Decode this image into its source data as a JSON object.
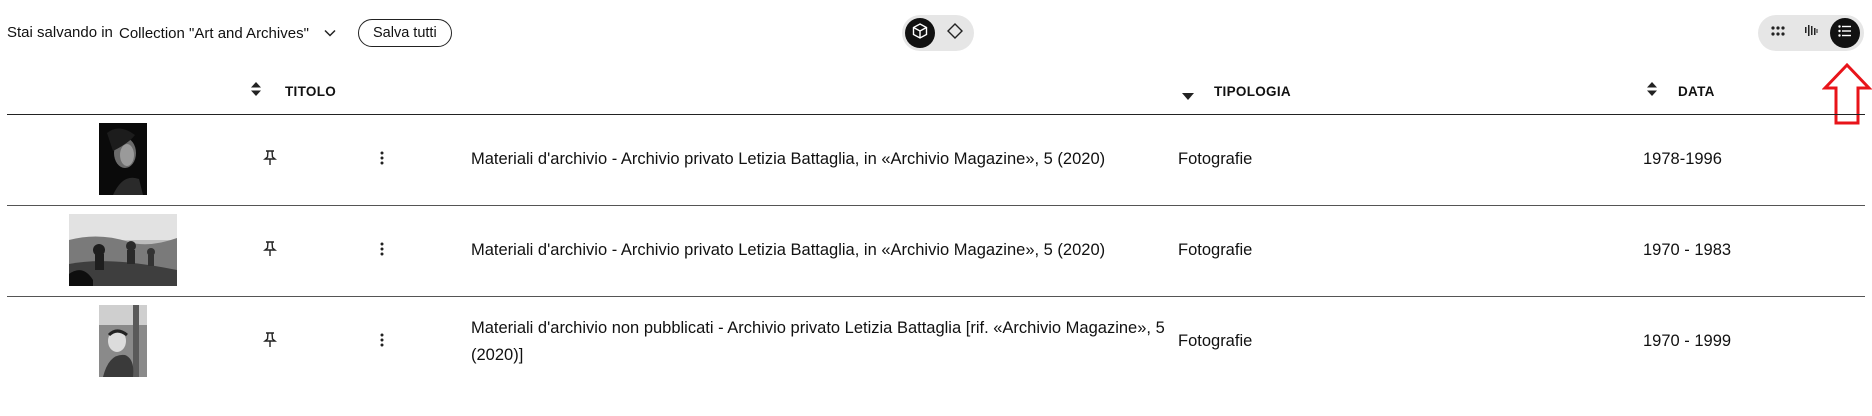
{
  "saving": {
    "label": "Stai salvando in",
    "collection": "Collection \"Art and Archives\"",
    "save_all": "Salva tutti"
  },
  "icons": {
    "collection_dropdown": "chevron-down-icon",
    "view_3d": "cube-icon",
    "view_2d": "diamond-icon",
    "layout_grid": "grid-icon",
    "layout_barcode": "barcode-icon",
    "layout_list": "list-icon",
    "pin": "pin-icon",
    "more": "more-vertical-icon",
    "annotation": "red-up-arrow-icon"
  },
  "colors": {
    "annotation": "#e8141a",
    "active_toggle": "#111111",
    "toggle_bg": "#e6e6e6"
  },
  "table": {
    "headers": {
      "title": "TITOLO",
      "type": "TIPOLOGIA",
      "date": "DATA"
    },
    "rows": [
      {
        "title": "Materiali d'archivio - Archivio privato Letizia Battaglia, in «Archivio Magazine», 5 (2020)",
        "type": "Fotografie",
        "date": "1978-1996"
      },
      {
        "title": "Materiali d'archivio - Archivio privato Letizia Battaglia, in «Archivio Magazine», 5 (2020)",
        "type": "Fotografie",
        "date": "1970 - 1983"
      },
      {
        "title": "Materiali d'archivio non pubblicati - Archivio privato Letizia Battaglia [rif. «Archivio Magazine», 5 (2020)]",
        "type": "Fotografie",
        "date": "1970 - 1999"
      }
    ]
  }
}
